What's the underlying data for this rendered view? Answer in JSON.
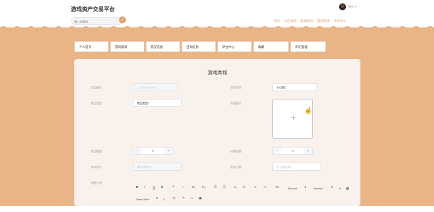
{
  "header": {
    "logo": "游戏资产交易平台",
    "search_placeholder": "输入关键词",
    "search_icon": "search-icon",
    "user_name": "张三 ▾",
    "links": [
      "首页",
      "公告通知",
      "新闻资讯",
      "游戏商城",
      "评估中心"
    ]
  },
  "colors": {
    "accent": "#e8a068",
    "band": "#e9b486",
    "panel": "#f9f2ec"
  },
  "nav": [
    "个人首页",
    "游戏商城",
    "购买信息",
    "咨询信息",
    "评估中心",
    "收藏",
    "评论管理"
  ],
  "form": {
    "title": "游戏商城",
    "product_no_label": "商品编号",
    "product_no_value": "1718690030566",
    "game_name_label": "游戏名称",
    "game_name_value": "XX游戏",
    "product_type_label": "商品类型",
    "product_type_value": "商品类型1",
    "cover_label": "封面图片",
    "quantity_label": "商品数量",
    "quantity_value": "0",
    "price_label": "价格金额",
    "price_value": "0",
    "publisher_label": "发布用户",
    "publisher_placeholder": "请选择发布",
    "publish_date_label": "发布日期",
    "publish_date_placeholder": "选择日期",
    "detail_label": "详细介绍",
    "toolbar": [
      "B",
      "I",
      "U",
      "S",
      "❝",
      "‹›",
      "H₁",
      "H₂",
      "☰",
      "☰",
      "x₂",
      "x²",
      "⇤",
      "⇥",
      "Tx"
    ],
    "toolbar_selects": [
      "Normal",
      "Normal"
    ],
    "font_select": "Sans Serif"
  }
}
